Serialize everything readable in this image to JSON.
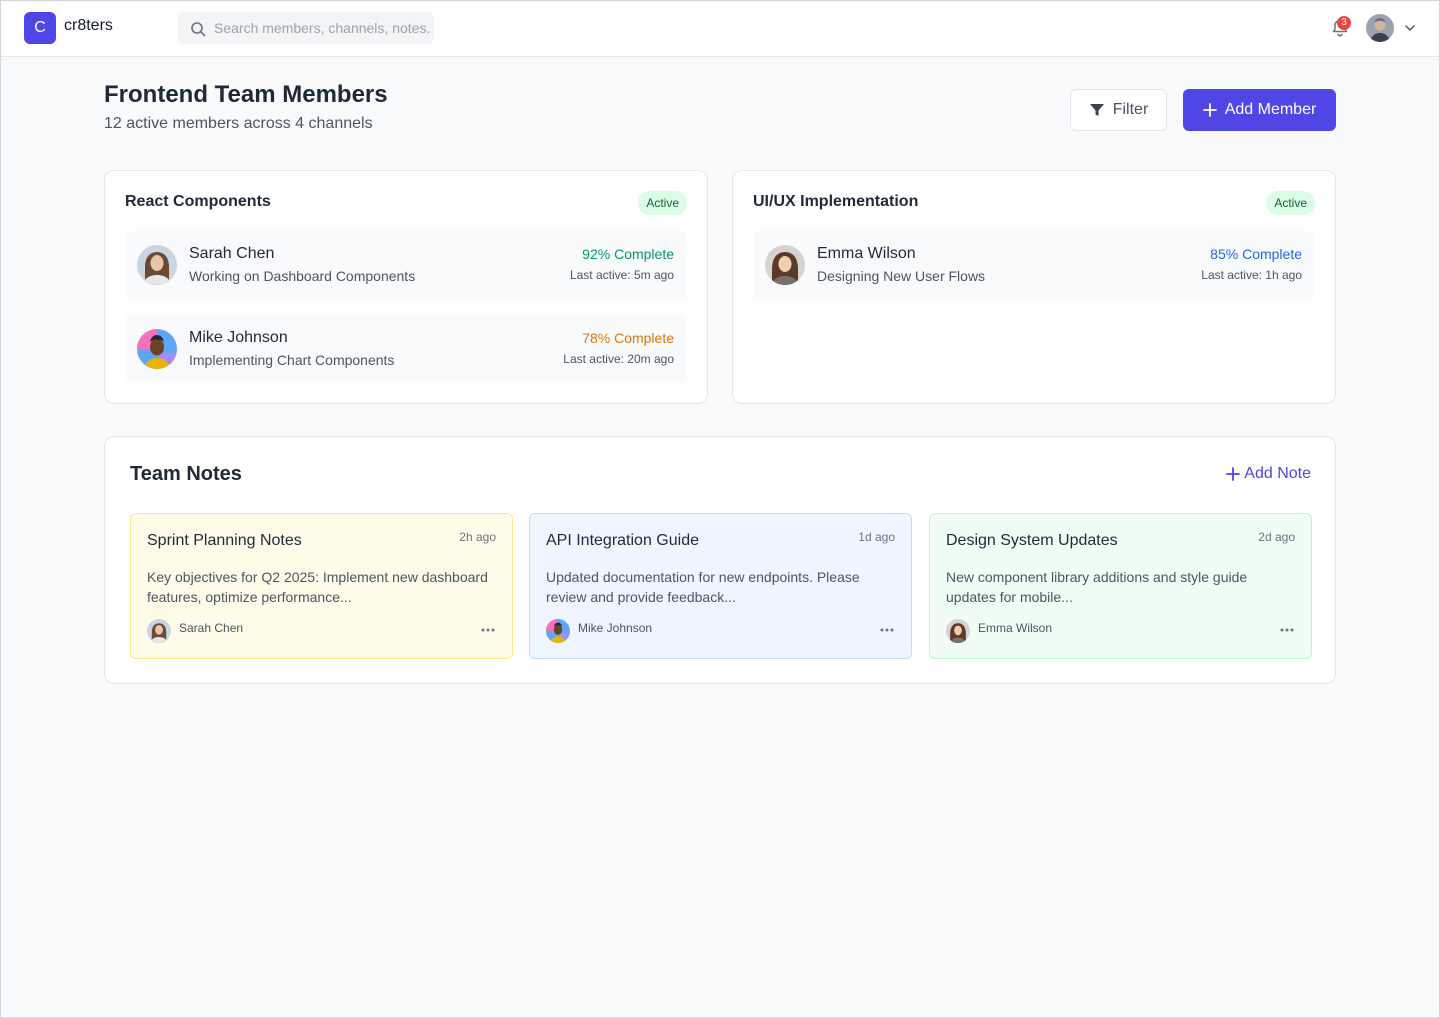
{
  "app": {
    "logo_letter": "C",
    "name": "cr8ters"
  },
  "search": {
    "placeholder": "Search members, channels, notes..."
  },
  "notifications": {
    "count": "3"
  },
  "header": {
    "title": "Frontend Team Members",
    "subtitle": "12 active members across 4 channels",
    "filter_label": "Filter",
    "add_member_label": "Add Member"
  },
  "channels": [
    {
      "title": "React Components",
      "status": "Active",
      "members": [
        {
          "name": "Sarah Chen",
          "task": "Working on Dashboard Components",
          "progress": "92% Complete",
          "progress_color": "#059669",
          "last_active": "Last active: 5m ago"
        },
        {
          "name": "Mike Johnson",
          "task": "Implementing Chart Components",
          "progress": "78% Complete",
          "progress_color": "#d97706",
          "last_active": "Last active: 20m ago"
        }
      ]
    },
    {
      "title": "UI/UX Implementation",
      "status": "Active",
      "members": [
        {
          "name": "Emma Wilson",
          "task": "Designing New User Flows",
          "progress": "85% Complete",
          "progress_color": "#2563eb",
          "last_active": "Last active: 1h ago"
        }
      ]
    }
  ],
  "notes": {
    "title": "Team Notes",
    "add_label": "Add Note",
    "items": [
      {
        "title": "Sprint Planning Notes",
        "time": "2h ago",
        "body": "Key objectives for Q2 2025: Implement new dashboard features, optimize performance...",
        "author": "Sarah Chen"
      },
      {
        "title": "API Integration Guide",
        "time": "1d ago",
        "body": "Updated documentation for new endpoints. Please review and provide feedback...",
        "author": "Mike Johnson"
      },
      {
        "title": "Design System Updates",
        "time": "2d ago",
        "body": "New component library additions and style guide updates for mobile...",
        "author": "Emma Wilson"
      }
    ]
  },
  "colors": {
    "accent": "#4f46e5",
    "badge_bg": "#dcfce7",
    "badge_text": "#166534",
    "notification": "#ef4444"
  }
}
